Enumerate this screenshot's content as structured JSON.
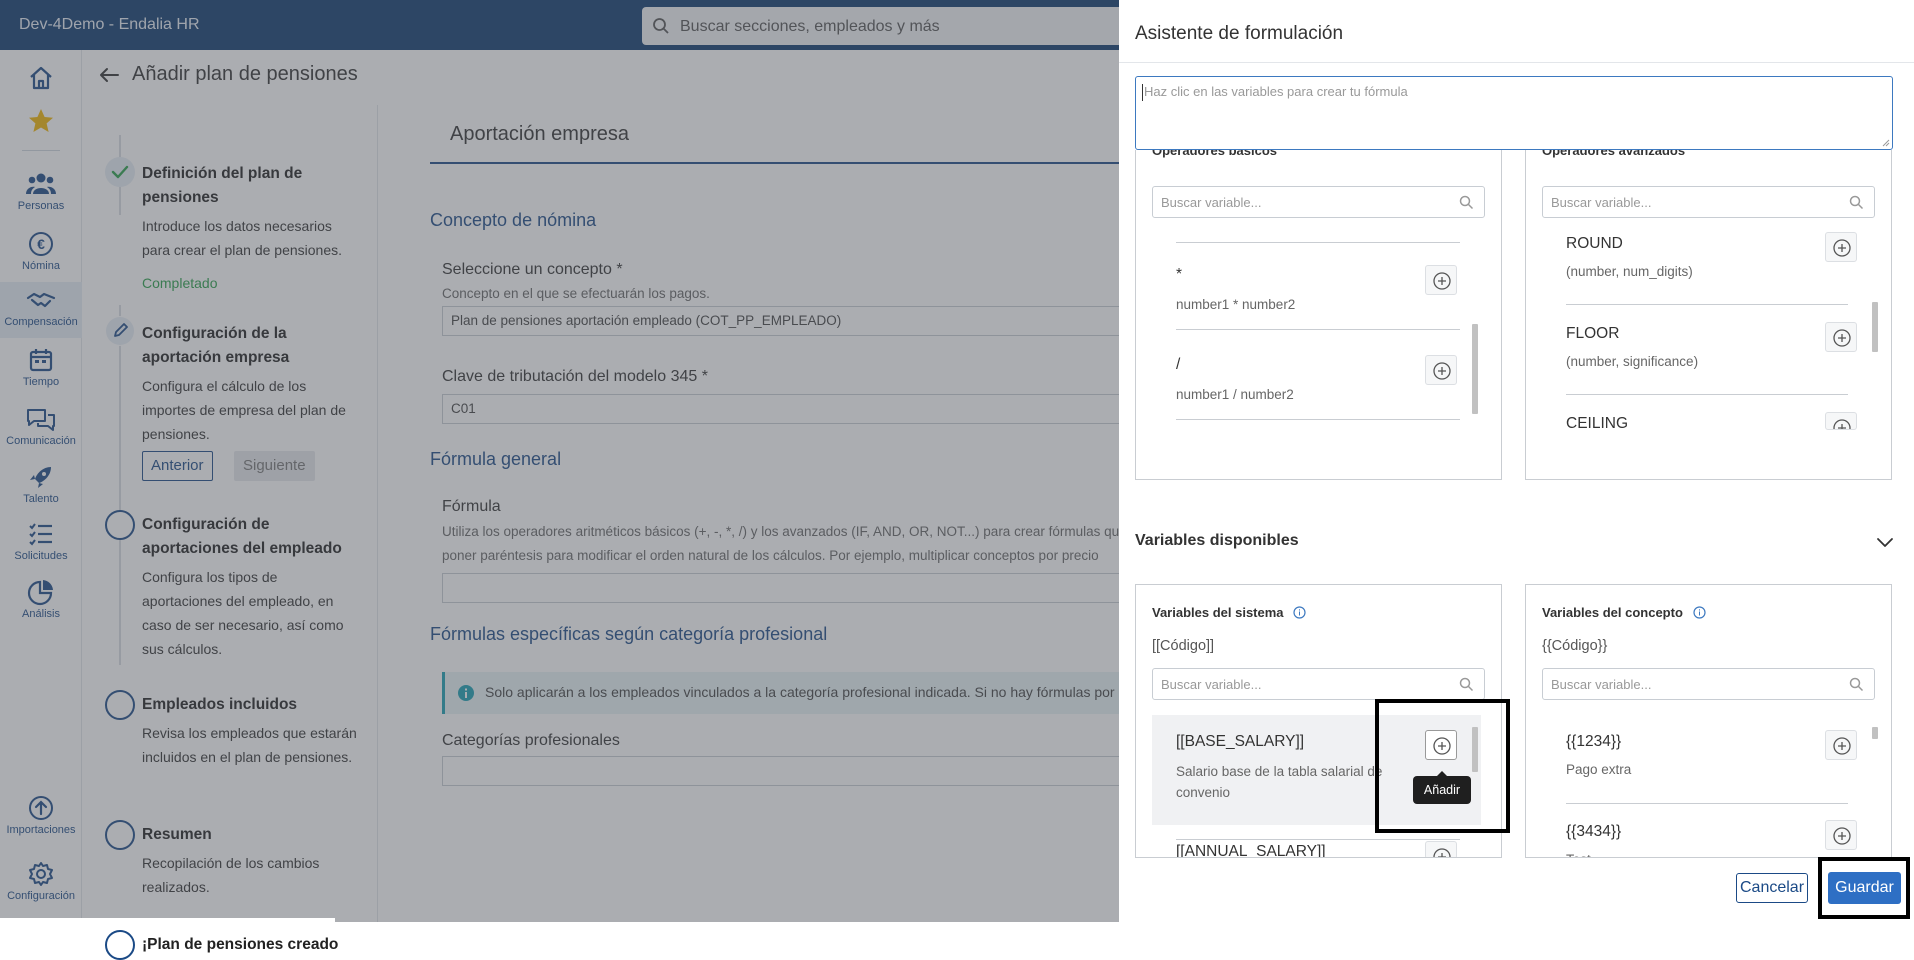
{
  "topbar": {
    "title": "Dev-4Demo - Endalia HR",
    "search_placeholder": "Buscar secciones, empleados y más"
  },
  "leftnav": {
    "items": [
      {
        "label": "",
        "icon": "home-icon"
      },
      {
        "label": "",
        "icon": "star-icon"
      },
      {
        "label": "Personas",
        "icon": "people-icon"
      },
      {
        "label": "Nómina",
        "icon": "euro-icon"
      },
      {
        "label": "Compensación",
        "icon": "handshake-icon"
      },
      {
        "label": "Tiempo",
        "icon": "calendar-icon"
      },
      {
        "label": "Comunicación",
        "icon": "chat-icon"
      },
      {
        "label": "Talento",
        "icon": "rocket-icon"
      },
      {
        "label": "Solicitudes",
        "icon": "list-check-icon"
      },
      {
        "label": "Análisis",
        "icon": "pie-chart-icon"
      },
      {
        "label": "Importaciones",
        "icon": "upload-icon"
      },
      {
        "label": "Configuración",
        "icon": "gear-icon"
      }
    ]
  },
  "page": {
    "title": "Añadir plan de pensiones",
    "steps": [
      {
        "name": "Definición del plan de pensiones",
        "desc": "Introduce los datos necesarios para crear el plan de pensiones.",
        "status": "Completado"
      },
      {
        "name": "Configuración de la aportación empresa",
        "desc": "Configura el cálculo de los importes de empresa del plan de pensiones.",
        "prev": "Anterior",
        "next": "Siguiente"
      },
      {
        "name": "Configuración de aportaciones del empleado",
        "desc": "Configura los tipos de aportaciones del empleado, en caso de ser necesario, así como sus cálculos."
      },
      {
        "name": "Empleados incluidos",
        "desc": "Revisa los empleados que estarán incluidos en el plan de pensiones."
      },
      {
        "name": "Resumen",
        "desc": "Recopilación de los cambios realizados."
      },
      {
        "name": "¡Plan de pensiones creado"
      }
    ],
    "tab_title": "Aportación empresa",
    "concepto_section": "Concepto de nómina",
    "concepto_label": "Seleccione un concepto *",
    "concepto_help": "Concepto en el que se efectuarán los pagos.",
    "concepto_value": "Plan de pensiones aportación empleado (COT_PP_EMPLEADO)",
    "clave_label": "Clave de tributación del modelo 345 *",
    "clave_value": "C01",
    "formula_section": "Fórmula general",
    "formula_label": "Fórmula",
    "formula_help": "Utiliza los operadores aritméticos básicos (+, -, *, /) y los avanzados (IF, AND, OR, NOT...) para crear fórmulas que poner paréntesis para modificar el orden natural de los cálculos. Por ejemplo, multiplicar conceptos por precio",
    "especificas_section": "Fórmulas específicas según categoría profesional",
    "info_text": "Solo aplicarán a los empleados vinculados a la categoría profesional indicada. Si no hay fórmulas por c",
    "categorias_label": "Categorías profesionales"
  },
  "drawer": {
    "title": "Asistente de formulación",
    "formula_placeholder": "Haz clic en las variables para crear tu fórmula",
    "basic_ops": {
      "title": "Operadores básicos",
      "search_placeholder": "Buscar variable...",
      "items": [
        {
          "name": "*",
          "desc": "number1 * number2"
        },
        {
          "name": "/",
          "desc": "number1 / number2"
        }
      ]
    },
    "advanced_ops": {
      "title": "Operadores avanzados",
      "search_placeholder": "Buscar variable...",
      "items": [
        {
          "name": "ROUND",
          "desc": "(number, num_digits)"
        },
        {
          "name": "FLOOR",
          "desc": "(number, significance)"
        },
        {
          "name": "CEILING",
          "desc": ""
        }
      ]
    },
    "vars_header": "Variables disponibles",
    "system_vars": {
      "title": "Variables del sistema",
      "hint": "[[Código]]",
      "search_placeholder": "Buscar variable...",
      "items": [
        {
          "name": "[[BASE_SALARY]]",
          "desc": "Salario base de la tabla salarial de convenio"
        },
        {
          "name": "[[ANNUAL_SALARY]]",
          "desc": ""
        }
      ]
    },
    "concept_vars": {
      "title": "Variables del concepto",
      "hint": "{{Código}}",
      "search_placeholder": "Buscar variable...",
      "items": [
        {
          "name": "{{1234}}",
          "desc": "Pago extra"
        },
        {
          "name": "{{3434}}",
          "desc": "Test"
        }
      ]
    },
    "tooltip": "Añadir",
    "cancel_label": "Cancelar",
    "save_label": "Guardar"
  },
  "colors": {
    "topbar": "#0f3a6e",
    "primary": "#1b4a86",
    "save_button": "#2e6fc4",
    "success": "#2aa04a"
  }
}
